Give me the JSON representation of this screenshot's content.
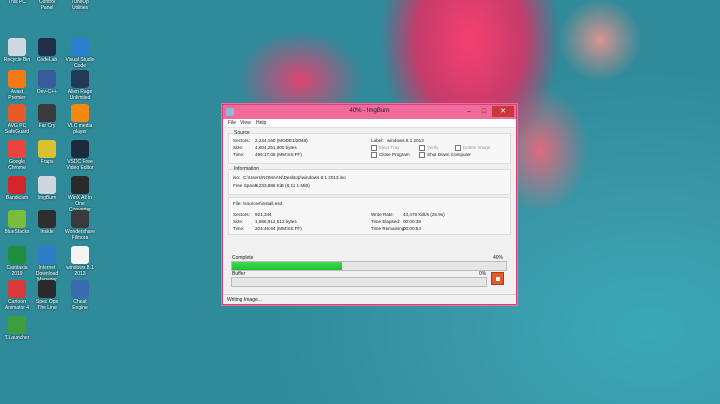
{
  "desktop_icons": [
    {
      "label": "This PC",
      "icon": "computer-icon",
      "color": "#3b8fd8"
    },
    {
      "label": "Control Panel",
      "icon": "control-panel-icon",
      "color": "#4f9fe0"
    },
    {
      "label": "TuneUp Utilities",
      "icon": "tuneup-icon",
      "color": "#2b6fb8"
    },
    {
      "label": "Recycle Bin",
      "icon": "recycle-bin-icon",
      "color": "#cfd8e0"
    },
    {
      "label": "CodeLab",
      "icon": "codelab-icon",
      "color": "#1f2f4a"
    },
    {
      "label": "Visual Studio Code",
      "icon": "vscode-icon",
      "color": "#2b7fd0"
    },
    {
      "label": "Avast Premier",
      "icon": "avast-icon",
      "color": "#f07a14"
    },
    {
      "label": "Dev-C++",
      "icon": "devcpp-icon",
      "color": "#3a5a9e"
    },
    {
      "label": "Alien Rage Unlimited",
      "icon": "game-icon",
      "color": "#223a58"
    },
    {
      "label": "AVG PC SafeGuard",
      "icon": "avg-icon",
      "color": "#e65b2a"
    },
    {
      "label": "Far Cry",
      "icon": "farcry-icon",
      "color": "#3a3a3a"
    },
    {
      "label": "VLC media player",
      "icon": "vlc-icon",
      "color": "#f08a10"
    },
    {
      "label": "Google Chrome",
      "icon": "chrome-icon",
      "color": "#e8453c"
    },
    {
      "label": "Fraps",
      "icon": "fraps-icon",
      "color": "#d9c230"
    },
    {
      "label": "VSDC Free Video Editor",
      "icon": "vsdc-icon",
      "color": "#1b2b3e"
    },
    {
      "label": "Bandicam",
      "icon": "bandicam-icon",
      "color": "#d2262b"
    },
    {
      "label": "ImgBurn",
      "icon": "imgburn-icon",
      "color": "#d0d6e0"
    },
    {
      "label": "WinX All in One Converter",
      "icon": "winx-icon",
      "color": "#2a2a2a"
    },
    {
      "label": "BlueStacks",
      "icon": "bluestacks-icon",
      "color": "#7bbd3a"
    },
    {
      "label": "Inside",
      "icon": "inside-icon",
      "color": "#2e2e2e"
    },
    {
      "label": "Wondershare Filmora",
      "icon": "filmora-icon",
      "color": "#3a3a3a"
    },
    {
      "label": "Camtasia 2019",
      "icon": "camtasia-icon",
      "color": "#1e8e3e"
    },
    {
      "label": "Internet Download Manager",
      "icon": "idm-icon",
      "color": "#2d7dc9"
    },
    {
      "label": "windows 8.1 2013",
      "icon": "disc-image-icon",
      "color": "#f4f4f4"
    },
    {
      "label": "Cartoon Animator 4",
      "icon": "cartoon-animator-icon",
      "color": "#d83a3a"
    },
    {
      "label": "Spec Ops The Line",
      "icon": "specops-icon",
      "color": "#2a2a2a"
    },
    {
      "label": "Cheat Engine",
      "icon": "cheat-engine-icon",
      "color": "#3a6ab0"
    },
    {
      "label": "T.Launcher",
      "icon": "tlauncher-icon",
      "color": "#3d9e3d"
    }
  ],
  "window": {
    "title": "40% - ImgBurn",
    "menu": [
      "File",
      "View",
      "Help"
    ],
    "source": {
      "group_title": "Source",
      "sectors_label": "Sectors:",
      "sectors_value": "2,244,160 (MODE1/2048)",
      "size_label": "Size:",
      "size_value": "4,604,251,600 bytes",
      "time_label": "Time:",
      "time_value": "499:17:05 (MM:SS:FF)",
      "label_label": "Label:",
      "label_value": "windows 8.1 2013",
      "eject_tray": "Eject Tray",
      "verify": "Verify",
      "delete_image": "Delete Image",
      "close_program": "Close Program",
      "shut_down": "Shut Down Computer"
    },
    "information": {
      "group_title": "Information",
      "iso_label": "iso:",
      "iso_value": "C:\\Users\\NOMAAN\\Desktop\\windows 8.1 2013.iso",
      "free_space_label": "Free Space:",
      "free_space_value": "9,233,886 KiB (8,11 1 MiB)"
    },
    "progress": {
      "file_label": "File:",
      "file_value": "\\sources\\install.esd",
      "sectors_label": "Sectors:",
      "sectors_value": "921,344",
      "size_label": "Size:",
      "size_value": "1,886,912,512 bytes",
      "time_label": "Time:",
      "time_value": "204:46:64 (MM:SS:FF)",
      "write_rate_label": "Write Rate:",
      "write_rate_value": "44,478 KiB/s (25.9x)",
      "time_elapsed_label": "Time Elapsed:",
      "time_elapsed_value": "00:00:38",
      "time_remaining_label": "Time Remaining:",
      "time_remaining_value": "00:00:54"
    },
    "complete_label": "Complete",
    "complete_percent_text": "40%",
    "complete_fraction": 0.4,
    "buffer_label": "Buffer",
    "buffer_percent_text": "0%",
    "buffer_fraction": 0.0,
    "status_text": "Writing Image..."
  },
  "colors": {
    "title_bar": "#f06a9c",
    "close_button": "#c9393b",
    "progress_fill": "#1fbf33",
    "stop_button": "#e25a27"
  }
}
